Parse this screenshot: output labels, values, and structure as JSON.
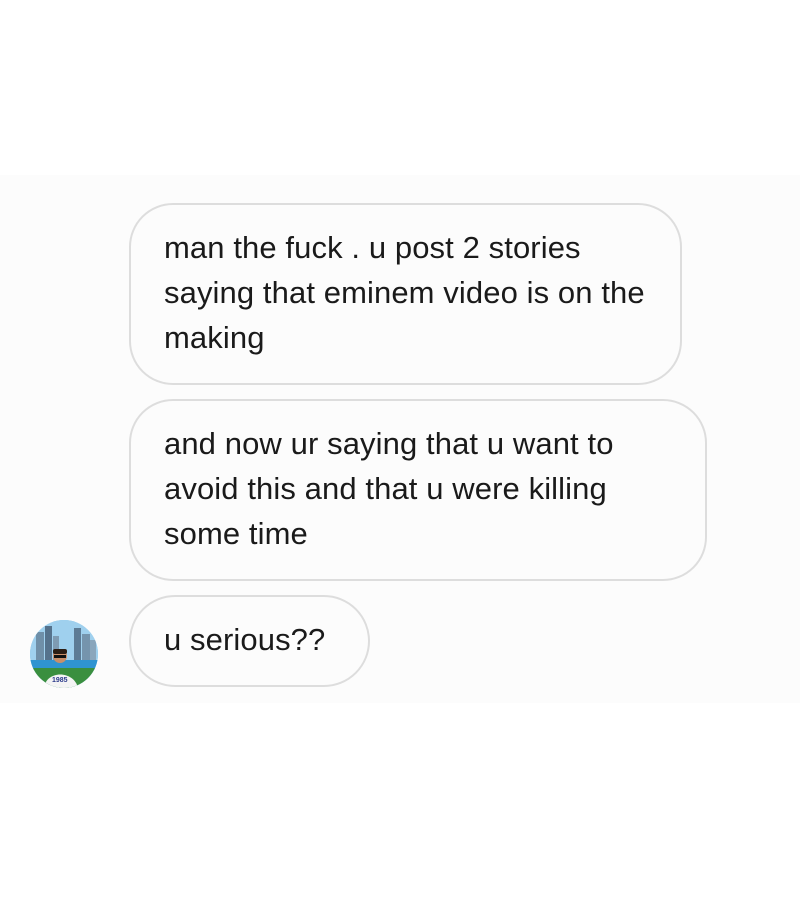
{
  "conversation": {
    "messages": [
      {
        "text": "man the fuck . u post 2 stories saying that eminem video is on the making"
      },
      {
        "text": "and now ur saying that u want to avoid this and that u were killing some time"
      },
      {
        "text": "u serious??"
      }
    ],
    "sender_avatar": {
      "icon": "profile-photo-avatar",
      "shirt_text": "1985"
    }
  },
  "colors": {
    "page_background": "#ffffff",
    "chat_background": "#fcfcfc",
    "bubble_border": "#dddddd",
    "text": "#1a1a1a"
  }
}
